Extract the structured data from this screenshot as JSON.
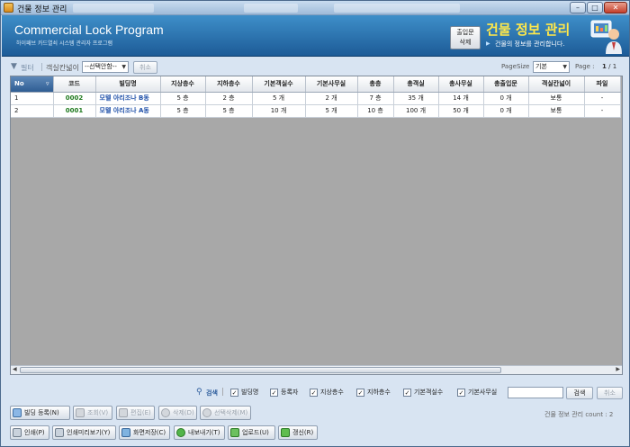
{
  "window": {
    "title": "건물 정보 관리",
    "controls": {
      "minimize": "–",
      "maximize": "□",
      "close": "✕"
    }
  },
  "banner": {
    "program_title": "Commercial Lock Program",
    "program_subtitle": "하이패브 카드열쇠 시스템 관리자 프로그램",
    "exit_delete_button": {
      "line1": "출입문",
      "line2": "삭제"
    },
    "main_title": "건물 정보 관리",
    "main_description": "건물의 정보를 관리합니다."
  },
  "filterbar": {
    "filter_label": "필터",
    "vacancy_label": "객실칸넓이",
    "vacancy_select": "--선택안함--",
    "cancel_button": "취소",
    "pagesize_label": "PageSize",
    "pagesize_value": "기본",
    "page_label": "Page :",
    "page_current": "1",
    "page_total": "/ 1"
  },
  "grid": {
    "columns": [
      "No",
      "코드",
      "빌딩명",
      "지상층수",
      "지하층수",
      "기본객실수",
      "기본사무실",
      "총층",
      "총객실",
      "총사무실",
      "총출입문",
      "객실칸넓이",
      "파일"
    ],
    "rows": [
      [
        "1",
        "0002",
        "모텔 아리조나 B동",
        "5 층",
        "2 층",
        "5 개",
        "2 개",
        "7 층",
        "35 개",
        "14 개",
        "0 개",
        "보통",
        "-"
      ],
      [
        "2",
        "0001",
        "모텔 아리조나 A동",
        "5 층",
        "5 층",
        "10 개",
        "5 개",
        "10 층",
        "100 개",
        "50 개",
        "0 개",
        "보통",
        "-"
      ]
    ]
  },
  "searchbar": {
    "search_label": "검색",
    "options": [
      {
        "label": "빌딩명",
        "checked": true
      },
      {
        "label": "등록자",
        "checked": true
      },
      {
        "label": "지상층수",
        "checked": true
      },
      {
        "label": "지하층수",
        "checked": true
      },
      {
        "label": "기본객실수",
        "checked": true
      },
      {
        "label": "기본사무실",
        "checked": true
      }
    ],
    "search_button": "검색",
    "cancel_button": "취소"
  },
  "actions_row1": {
    "register": "빌딩 등록(N)",
    "view": "조회(V)",
    "edit": "편집(E)",
    "delete": "삭제(D)",
    "delete_selected": "선택삭제(M)"
  },
  "actions_row2": {
    "print": "인쇄(P)",
    "print_preview": "인쇄미리보기(Y)",
    "save_screen": "화면저장(C)",
    "export": "내보내기(T)",
    "upload": "업로드(U)",
    "renew": "갱신(R)"
  },
  "status": {
    "count_text": "건물 정보 관리 count : 2"
  },
  "colors": {
    "banner": "#2a73b3",
    "title_yellow": "#ffe84a",
    "grid_bg": "#a8a8a8",
    "code_green": "#1f7a1f",
    "name_blue": "#1e4fa8"
  }
}
